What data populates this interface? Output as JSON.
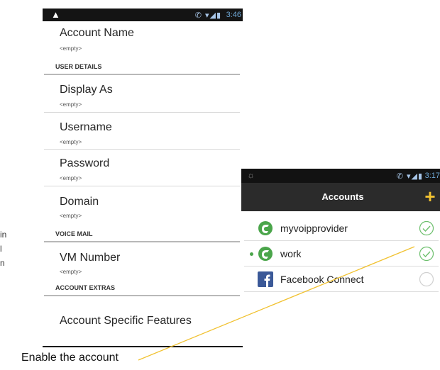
{
  "left_screen": {
    "status_bar": {
      "alert_icon": "warning-icon",
      "time": "3:46"
    },
    "fields": [
      {
        "title": "Account Name",
        "value": "<empty>"
      }
    ],
    "categories": {
      "user_details": "USER DETAILS",
      "voice_mail": "VOICE MAIL",
      "account_extras": "ACCOUNT EXTRAS"
    },
    "user_details": [
      {
        "title": "Display As",
        "value": "<empty>"
      },
      {
        "title": "Username",
        "value": "<empty>"
      },
      {
        "title": "Password",
        "value": "<empty>"
      },
      {
        "title": "Domain",
        "value": "<empty>"
      }
    ],
    "voice_mail": [
      {
        "title": "VM Number",
        "value": "<empty>"
      }
    ],
    "account_extras": [
      {
        "title": "Account Specific Features"
      }
    ]
  },
  "right_screen": {
    "status_bar": {
      "time": "3:17"
    },
    "action_bar": {
      "title": "Accounts",
      "add_icon": "plus-icon"
    },
    "accounts": [
      {
        "label": "myvoipprovider",
        "icon": "csipsimple-icon",
        "enabled": true,
        "active": false
      },
      {
        "label": "work",
        "icon": "csipsimple-icon",
        "enabled": true,
        "active": true
      },
      {
        "label": "Facebook Connect",
        "icon": "facebook-icon",
        "enabled": false,
        "active": false
      }
    ]
  },
  "annotation": {
    "caption": "Enable the account",
    "cut_off_text": [
      "in",
      "l",
      "n"
    ],
    "line_color": "#f1c232"
  }
}
